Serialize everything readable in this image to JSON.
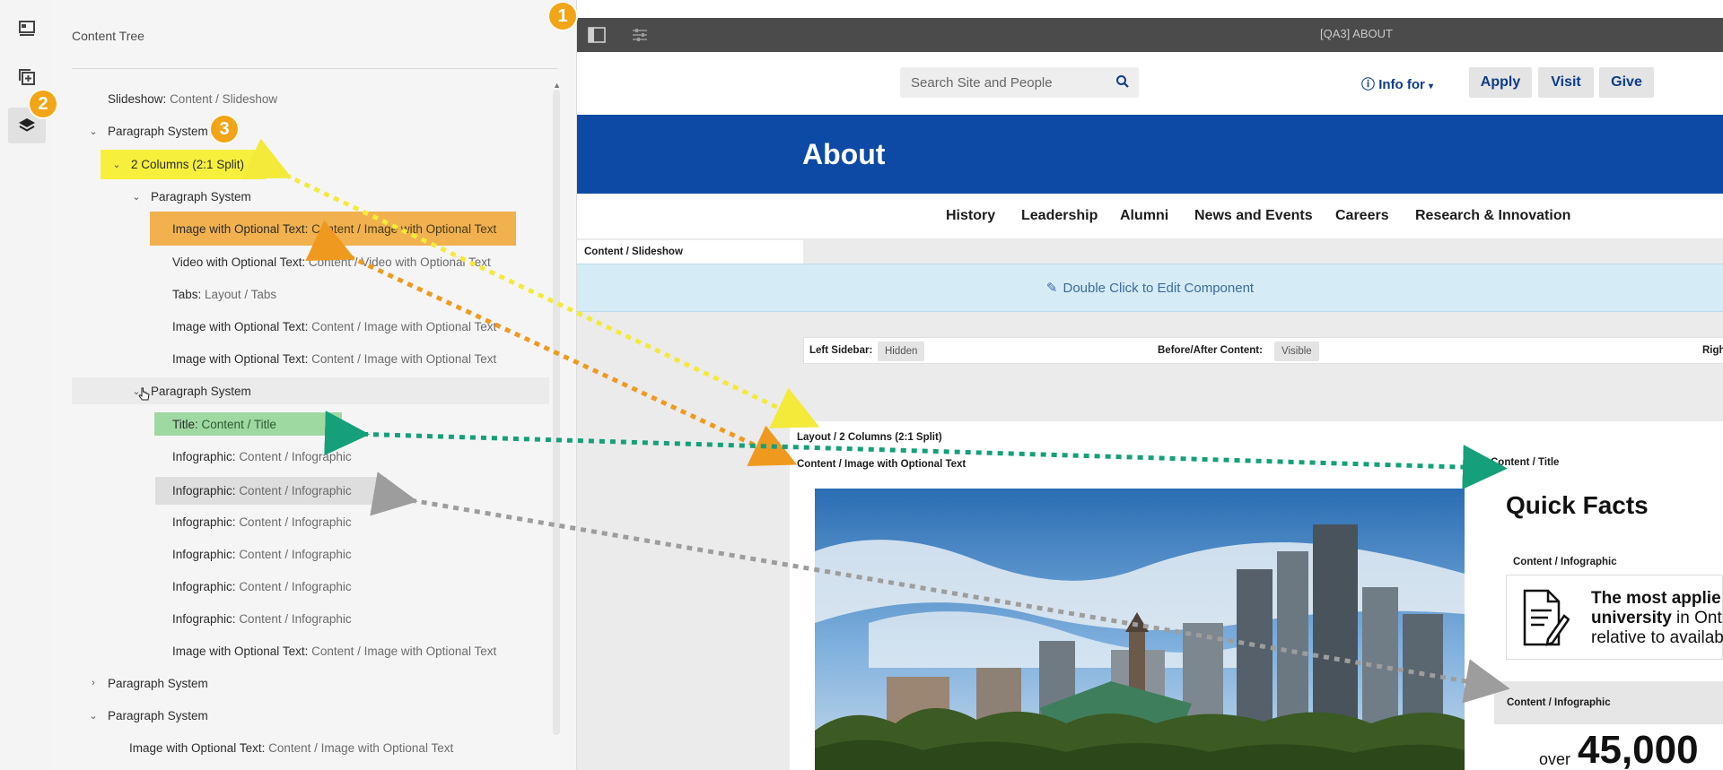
{
  "badges": [
    "1",
    "2",
    "3"
  ],
  "rail": {
    "icons": [
      "page-info-icon",
      "add-component-icon",
      "layers-icon"
    ]
  },
  "tree": {
    "title": "Content Tree",
    "rows": [
      {
        "label": "Slideshow:",
        "path": "Content / Slideshow",
        "chevron": ""
      },
      {
        "label": "Paragraph System",
        "path": "",
        "chevron": "down"
      },
      {
        "label": "2 Columns (2:1 Split)",
        "path": "",
        "chevron": "down"
      },
      {
        "label": "Paragraph System",
        "path": "",
        "chevron": "down"
      },
      {
        "label": "Image with Optional Text:",
        "path": "Content / Image with Optional Text",
        "chevron": ""
      },
      {
        "label": "Video with Optional Text:",
        "path": "Content / Video with Optional Text",
        "chevron": ""
      },
      {
        "label": "Tabs:",
        "path": "Layout / Tabs",
        "chevron": ""
      },
      {
        "label": "Image with Optional Text:",
        "path": "Content / Image with Optional Text",
        "chevron": ""
      },
      {
        "label": "Image with Optional Text:",
        "path": "Content / Image with Optional Text",
        "chevron": ""
      },
      {
        "label": "Paragraph System",
        "path": "",
        "chevron": "down"
      },
      {
        "label": "Title:",
        "path": "Content / Title",
        "chevron": ""
      },
      {
        "label": "Infographic:",
        "path": "Content / Infographic",
        "chevron": ""
      },
      {
        "label": "Infographic:",
        "path": "Content / Infographic",
        "chevron": ""
      },
      {
        "label": "Infographic:",
        "path": "Content / Infographic",
        "chevron": ""
      },
      {
        "label": "Infographic:",
        "path": "Content / Infographic",
        "chevron": ""
      },
      {
        "label": "Infographic:",
        "path": "Content / Infographic",
        "chevron": ""
      },
      {
        "label": "Infographic:",
        "path": "Content / Infographic",
        "chevron": ""
      },
      {
        "label": "Image with Optional Text:",
        "path": "Content / Image with Optional Text",
        "chevron": ""
      },
      {
        "label": "Paragraph System",
        "path": "",
        "chevron": "right"
      },
      {
        "label": "Paragraph System",
        "path": "",
        "chevron": "down"
      },
      {
        "label": "Image with Optional Text:",
        "path": "Content / Image with Optional Text",
        "chevron": ""
      }
    ]
  },
  "editor": {
    "page_title": "[QA3] ABOUT",
    "search_placeholder": "Search Site and People",
    "info_for": "Info for",
    "header_buttons": [
      "Apply",
      "Visit",
      "Give"
    ],
    "banner_title": "About",
    "subnav": [
      "History",
      "Leadership",
      "Alumni",
      "News and Events",
      "Careers",
      "Research & Innovation"
    ],
    "slideshow_label": "Content / Slideshow",
    "slideshow_edit": "Double Click to Edit Component",
    "left_sidebar_label": "Left Sidebar:",
    "left_sidebar_value": "Hidden",
    "before_after_label": "Before/After Content:",
    "before_after_value": "Visible",
    "right_label_partial": "Righ",
    "layout_label": "Layout / 2 Columns (2:1 Split)",
    "image_label": "Content / Image with Optional Text",
    "title_label": "Content / Title",
    "quick_facts": "Quick Facts",
    "infographic_label": "Content / Infographic",
    "infographic_line1": "The most applie",
    "infographic_line2_bold": "university",
    "infographic_line2_rest": " in Ont",
    "infographic_line3": "relative to availab",
    "infographic_label2": "Content / Infographic",
    "stat_prefix": "over",
    "stat_value": "45,000"
  },
  "colors": {
    "badge": "#f2a516",
    "highlight_yellow": "#f6f03d",
    "highlight_orange": "#f0b14e",
    "highlight_green": "#9fd9a2",
    "highlight_gray": "#dedede",
    "brand_blue": "#0d4aa5"
  }
}
